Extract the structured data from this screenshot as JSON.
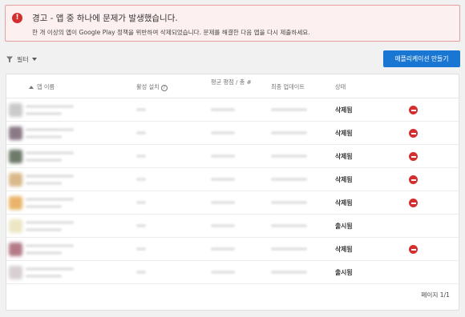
{
  "alert": {
    "icon": "error-icon",
    "title": "경고 - 앱 중 하나에 문제가 발생했습니다.",
    "description": "한 개 이상의 앱이 Google Play 정책을 위반하여 삭제되었습니다. 문제를 해결한 다음 앱을 다시 제출하세요."
  },
  "toolbar": {
    "filter_label": "필터",
    "create_button": "애플리케이션 만들기"
  },
  "table": {
    "columns": [
      "앱 이름",
      "활성 설치",
      "평균 평점 / 총 #",
      "최종 업데이트",
      "상태"
    ],
    "rows": [
      {
        "status": "삭제됨",
        "removed": true,
        "thumb_color": "#c9c9c9"
      },
      {
        "status": "삭제됨",
        "removed": true,
        "thumb_color": "#8a7a86"
      },
      {
        "status": "삭제됨",
        "removed": true,
        "thumb_color": "#6e7a6a"
      },
      {
        "status": "삭제됨",
        "removed": true,
        "thumb_color": "#d9b98a"
      },
      {
        "status": "삭제됨",
        "removed": true,
        "thumb_color": "#e9b46a"
      },
      {
        "status": "출시됨",
        "removed": false,
        "thumb_color": "#ece6c4"
      },
      {
        "status": "삭제됨",
        "removed": true,
        "thumb_color": "#b47a88"
      },
      {
        "status": "출시됨",
        "removed": false,
        "thumb_color": "#d7cfd2"
      }
    ]
  },
  "pagination": "페이지 1/1",
  "colors": {
    "accent": "#1976d2",
    "danger": "#d32f2f",
    "alert_bg": "#fdf0f0"
  }
}
